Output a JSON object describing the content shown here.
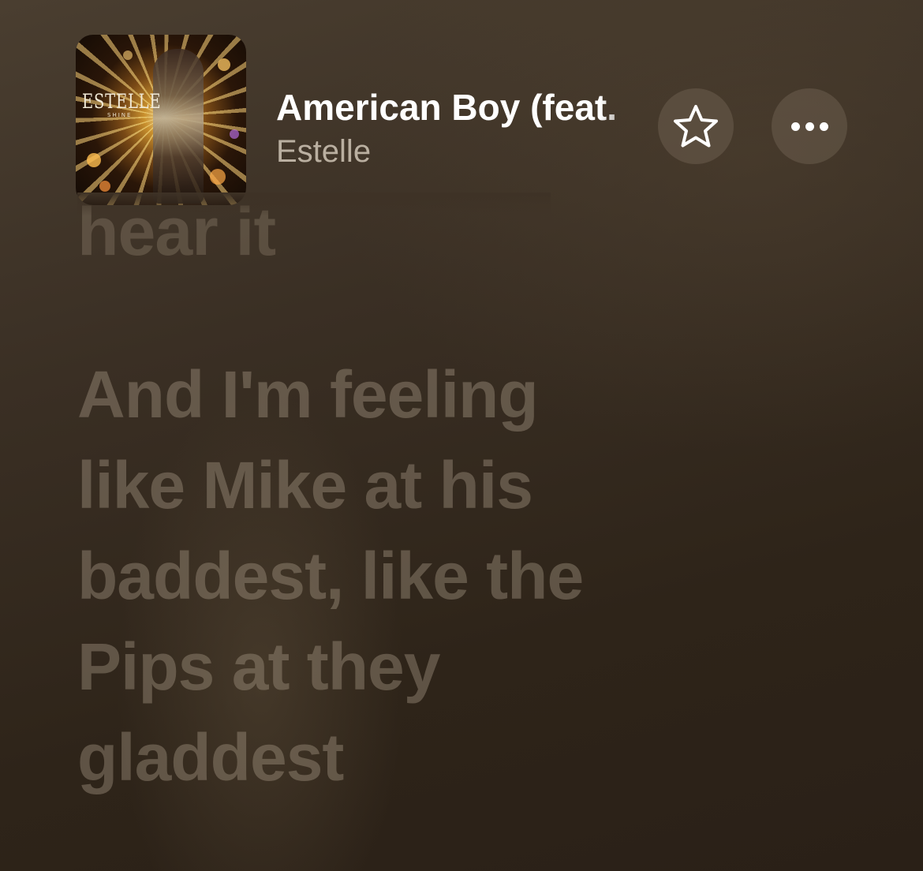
{
  "header": {
    "album_logo_text": "ESTELLE",
    "album_subtitle": "SHINE",
    "song_title": "American Boy (feat.",
    "artist": "Estelle",
    "favorite_icon": "star-icon",
    "more_icon": "ellipsis-icon"
  },
  "lyrics": {
    "previous_line": "hear it",
    "current_lines": [
      "And I'm feeling",
      "like Mike at his",
      "baddest, like the",
      "Pips at they",
      "gladdest"
    ]
  },
  "colors": {
    "background": "#33281e",
    "title": "#ffffff",
    "artist": "#d8cfc0",
    "lyric_inactive": "#8c7d6a",
    "button_bg": "#6b5c4c"
  }
}
